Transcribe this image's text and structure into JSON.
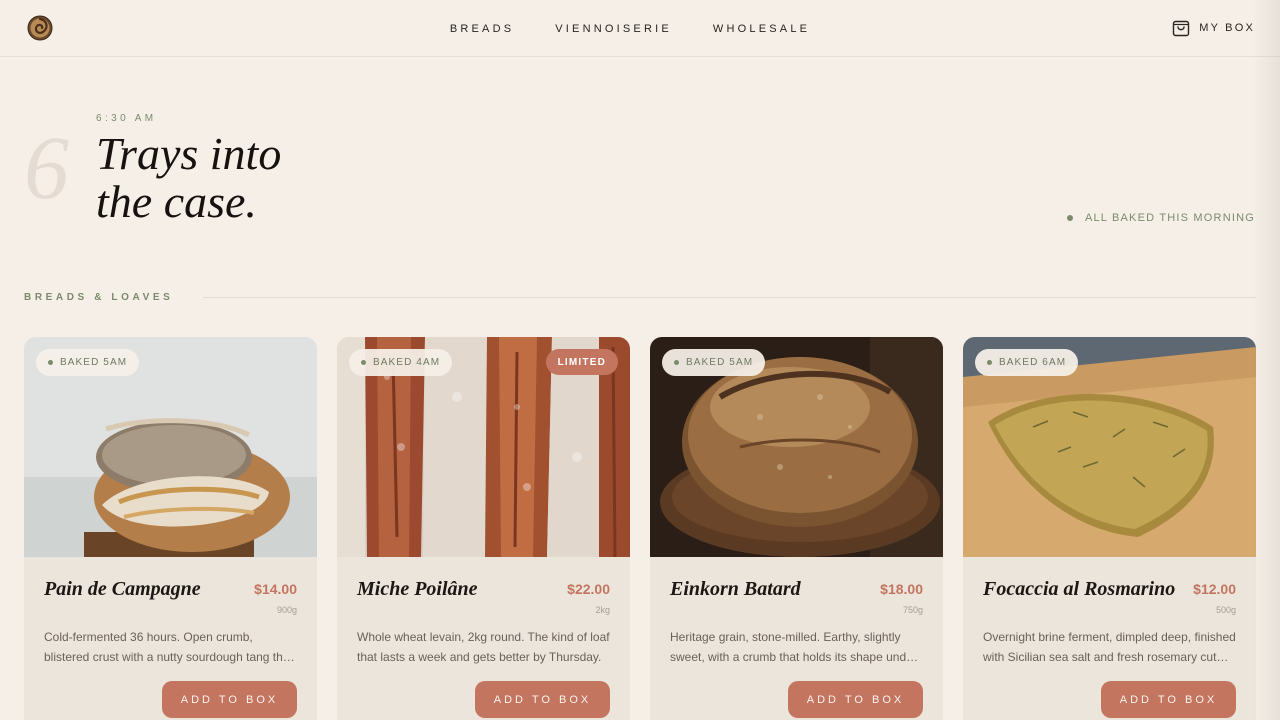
{
  "nav": {
    "links": [
      "BREADS",
      "VIENNOISERIE",
      "WHOLESALE"
    ],
    "box_label": "MY BOX"
  },
  "hero": {
    "number": "6",
    "time": "6:30 AM",
    "title_line1": "Trays into",
    "title_line2": "the case.",
    "baked_note": "ALL BAKED THIS MORNING"
  },
  "section": {
    "label": "BREADS & LOAVES"
  },
  "products": [
    {
      "badge": "BAKED 5AM",
      "tag": "",
      "name": "Pain de Campagne",
      "price": "$14.00",
      "weight": "900g",
      "description": "Cold-fermented 36 hours. Open crumb, blistered crust with a nutty sourdough tang th…",
      "button": "ADD TO BOX",
      "image": "sliced-sourdough-round"
    },
    {
      "badge": "BAKED 4AM",
      "tag": "LIMITED",
      "name": "Miche Poilâne",
      "price": "$22.00",
      "weight": "2kg",
      "description": "Whole wheat levain, 2kg round. The kind of loaf that lasts a week and gets better by Thursday.",
      "button": "ADD TO BOX",
      "image": "floured-baguettes"
    },
    {
      "badge": "BAKED 5AM",
      "tag": "",
      "name": "Einkorn Batard",
      "price": "$18.00",
      "weight": "750g",
      "description": "Heritage grain, stone-milled. Earthy, slightly sweet, with a crumb that holds its shape und…",
      "button": "ADD TO BOX",
      "image": "dark-boule-on-board"
    },
    {
      "badge": "BAKED 6AM",
      "tag": "",
      "name": "Focaccia al Rosmarino",
      "price": "$12.00",
      "weight": "500g",
      "description": "Overnight brine ferment, dimpled deep, finished with Sicilian sea salt and fresh rosemary cut…",
      "button": "ADD TO BOX",
      "image": "rosemary-focaccia"
    }
  ],
  "colors": {
    "background": "#f5efe8",
    "card": "#ece5dc",
    "accent": "#c4755f",
    "sage": "#7b8b6a"
  }
}
